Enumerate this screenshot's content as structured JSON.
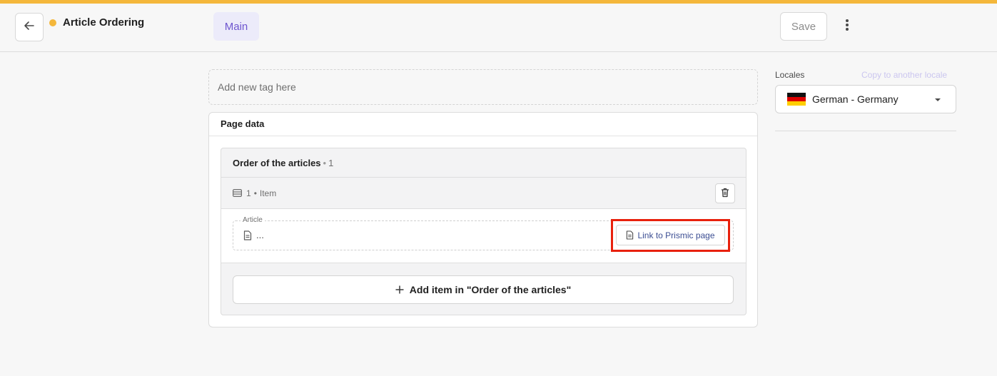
{
  "header": {
    "title": "Article Ordering",
    "tab_label": "Main",
    "save_label": "Save"
  },
  "tag_input": {
    "placeholder": "Add new tag here"
  },
  "page_data": {
    "title": "Page data",
    "group": {
      "title": "Order of the articles",
      "separator": "•",
      "count": "1",
      "item_index": "1",
      "item_separator": "•",
      "item_label": "Item",
      "field": {
        "label": "Article",
        "value": "...",
        "link_button": "Link to Prismic page"
      },
      "add_button": "Add item in \"Order of the articles\""
    }
  },
  "locales": {
    "label": "Locales",
    "copy_label": "Copy to another locale",
    "selected": "German - Germany"
  },
  "colors": {
    "accent": "#6e56cf",
    "status_dot": "#f4b73b",
    "highlight": "#e8200c"
  },
  "icons": [
    "arrow-left-icon",
    "more-vertical-icon",
    "lines-icon",
    "trash-icon",
    "document-icon",
    "plus-icon",
    "german-flag-icon",
    "chevron-down-icon"
  ]
}
